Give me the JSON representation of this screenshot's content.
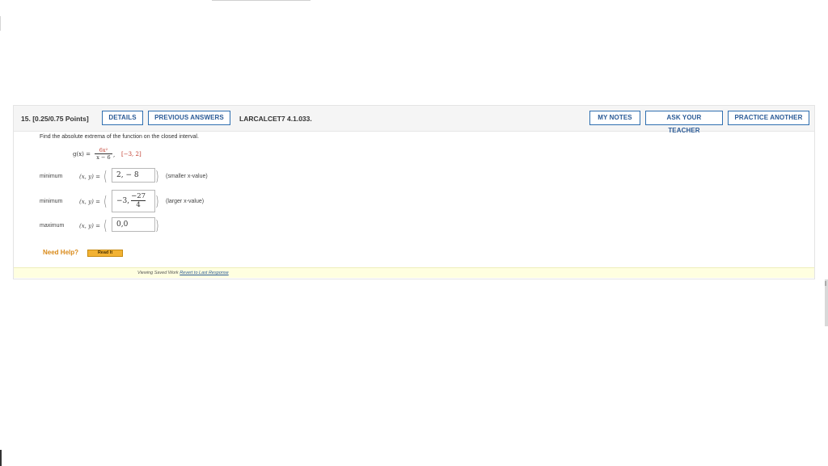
{
  "question": {
    "number": "15.",
    "points": "[0.25/0.75 Points]",
    "buttons": {
      "details": "DETAILS",
      "previous_answers": "PREVIOUS ANSWERS",
      "my_notes": "MY NOTES",
      "ask_teacher": "ASK YOUR TEACHER",
      "practice_another": "PRACTICE ANOTHER"
    },
    "code": "LARCALCET7 4.1.033.",
    "prompt": "Find the absolute extrema of the function on the closed interval.",
    "function": {
      "lhs": "g(x) =",
      "numerator": "6x²",
      "denominator": "x − 6",
      "separator": ",",
      "interval": "[−3, 2]"
    },
    "rows": [
      {
        "label": "minimum",
        "xy": "(x, y)",
        "eq": "=",
        "open": "(",
        "answer": "2, − 8",
        "close": ")",
        "note": "(smaller x-value)"
      },
      {
        "label": "minimum",
        "xy": "(x, y)",
        "eq": "=",
        "open": "(",
        "answer_prefix": "−3,",
        "answer_num": "−27",
        "answer_den": "4",
        "close": ")",
        "note": "(larger x-value)"
      },
      {
        "label": "maximum",
        "xy": "(x, y)",
        "eq": "=",
        "open": "(",
        "answer": "0,0",
        "close": ")"
      }
    ],
    "need_help": "Need Help?",
    "read_it": "Read It",
    "saved_status": "Viewing Saved Work",
    "revert_link": "Revert to Last Response"
  },
  "colors": {
    "button_border": "#2f6fb0",
    "button_text": "#2a5a96",
    "need_help": "#d98a1a",
    "read_it_bg": "#f2b233",
    "saved_bar": "#ffffe0",
    "math_red": "#c0392b"
  }
}
